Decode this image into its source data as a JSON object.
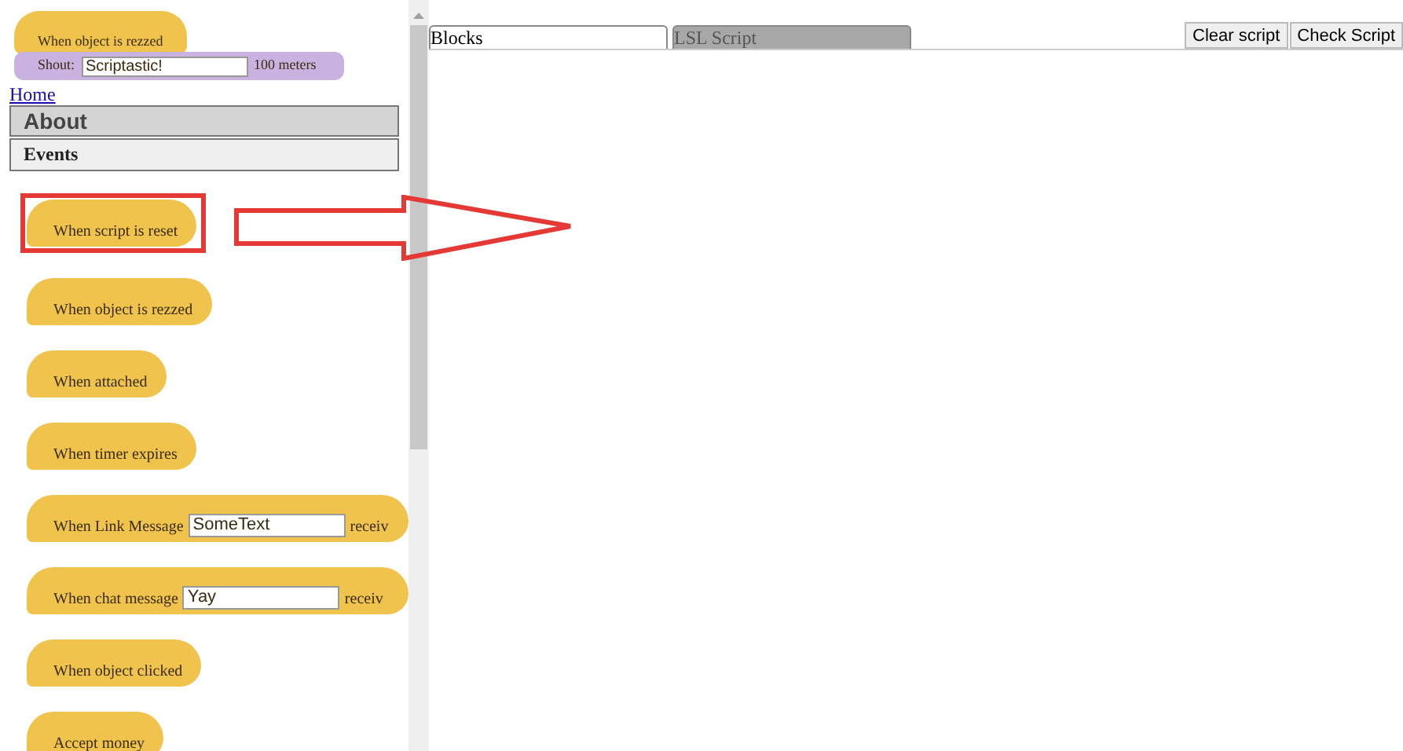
{
  "preview": {
    "event": "When object is rezzed",
    "action": {
      "label": "Shout:",
      "value": "Scriptastic!",
      "suffix": "100 meters"
    }
  },
  "nav": {
    "link": "Home",
    "sections": [
      {
        "label": "About",
        "kind": "grey"
      },
      {
        "label": "Events",
        "kind": "light"
      }
    ]
  },
  "blocks": [
    {
      "kind": "simple",
      "label": "When script is reset",
      "highlighted": true
    },
    {
      "kind": "simple",
      "label": "When object is rezzed",
      "highlighted": false
    },
    {
      "kind": "simple",
      "label": "When attached",
      "highlighted": false
    },
    {
      "kind": "simple",
      "label": "When timer expires",
      "highlighted": false
    },
    {
      "kind": "input",
      "label": "When Link Message",
      "value": "SomeText",
      "suffix": "receiv",
      "highlighted": false
    },
    {
      "kind": "input",
      "label": "When chat message",
      "value": "Yay",
      "suffix": "receiv",
      "highlighted": false
    },
    {
      "kind": "simple",
      "label": "When object clicked",
      "highlighted": false
    },
    {
      "kind": "simple",
      "label": "Accept money",
      "highlighted": false
    }
  ],
  "tabs": [
    {
      "label": "Blocks",
      "selected": true
    },
    {
      "label": "LSL Script",
      "selected": false
    }
  ],
  "buttons": [
    "Clear script",
    "Check Script"
  ]
}
